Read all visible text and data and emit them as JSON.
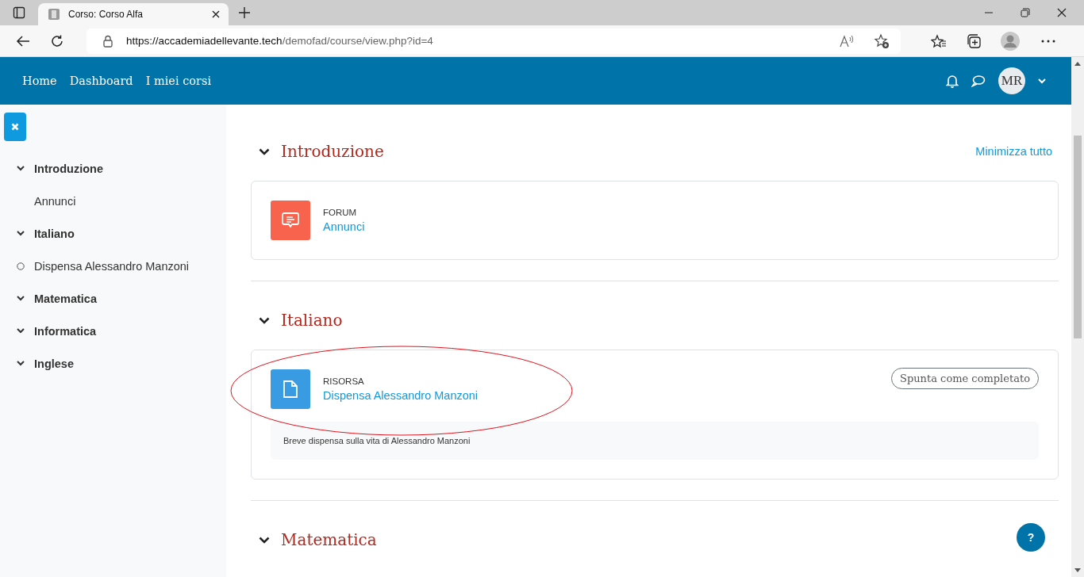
{
  "browser": {
    "tab_title": "Corso: Corso Alfa",
    "url_host": "https://accademiadellevante.tech",
    "url_path": "/demofad/course/view.php?id=4"
  },
  "navbar": {
    "links": [
      "Home",
      "Dashboard",
      "I miei corsi"
    ],
    "avatar": "MR"
  },
  "sidebar": {
    "sections": [
      {
        "label": "Introduzione",
        "expanded": true,
        "items": [
          {
            "label": "Annunci"
          }
        ]
      },
      {
        "label": "Italiano",
        "expanded": true,
        "items": [
          {
            "label": "Dispensa Alessandro Manzoni",
            "completed": false
          }
        ]
      },
      {
        "label": "Matematica",
        "expanded": true
      },
      {
        "label": "Informatica",
        "expanded": true
      },
      {
        "label": "Inglese",
        "expanded": true
      }
    ]
  },
  "collapse_all": "Minimizza tutto",
  "sections": [
    {
      "title": "Introduzione",
      "expanded": true,
      "activities": [
        {
          "kind": "forum",
          "type_label": "FORUM",
          "name": "Annunci"
        }
      ]
    },
    {
      "title": "Italiano",
      "expanded": true,
      "activities": [
        {
          "kind": "resource",
          "type_label": "RISORSA",
          "name": "Dispensa Alessandro Manzoni",
          "completion_button": "Spunta come completato",
          "description": "Breve dispensa sulla vita di Alessandro Manzoni"
        }
      ]
    },
    {
      "title": "Matematica",
      "expanded": true
    }
  ],
  "help": "?"
}
